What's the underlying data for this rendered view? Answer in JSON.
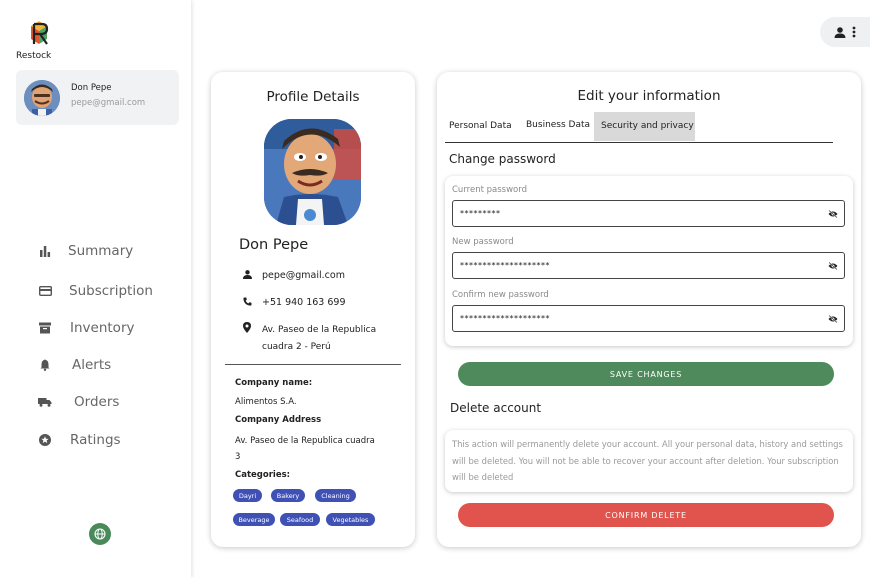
{
  "brand": {
    "name": "Restock"
  },
  "user": {
    "name": "Don Pepe",
    "email": "pepe@gmail.com"
  },
  "nav": {
    "items": [
      {
        "label": "Summary",
        "icon": "bar-chart-icon"
      },
      {
        "label": "Subscription",
        "icon": "credit-card-icon"
      },
      {
        "label": "Inventory",
        "icon": "archive-icon"
      },
      {
        "label": "Alerts",
        "icon": "bell-icon"
      },
      {
        "label": "Orders",
        "icon": "truck-icon"
      },
      {
        "label": "Ratings",
        "icon": "star-circle-icon"
      }
    ]
  },
  "profile": {
    "title": "Profile Details",
    "name": "Don Pepe",
    "email": "pepe@gmail.com",
    "phone": "+51 940 163 699",
    "address_line1": "Av. Paseo de la Republica",
    "address_line2": "cuadra 2 - Perú",
    "company_name_label": "Company name:",
    "company_name": "Alimentos S.A.",
    "company_address_label": "Company Address",
    "company_address_line1": "Av. Paseo de la Republica cuadra",
    "company_address_line2": "3",
    "categories_label": "Categories:",
    "categories": [
      "Dayri",
      "Bakery",
      "Cleaning",
      "Beverage",
      "Seafood",
      "Vegetables"
    ]
  },
  "edit": {
    "title": "Edit your information",
    "tabs": [
      "Personal Data",
      "Business Data",
      "Security and privacy"
    ],
    "active_tab": "Security and privacy",
    "change_password_title": "Change password",
    "current_password_label": "Current password",
    "current_password_value": "*********",
    "new_password_label": "New password",
    "new_password_value": "********************",
    "confirm_password_label": "Confirm new password",
    "confirm_password_value": "********************",
    "save_label": "SAVE CHANGES",
    "delete_title": "Delete account",
    "delete_warning": "This action will permanently delete your account. All your personal data, history and settings will be deleted. You will not be able to recover your account after deletion. Your subscription will be deleted",
    "delete_label": "CONFIRM DELETE"
  },
  "colors": {
    "save": "#4e8a5c",
    "delete": "#e0544d",
    "chip": "#3f51b5",
    "globe": "#4a8a5a"
  }
}
